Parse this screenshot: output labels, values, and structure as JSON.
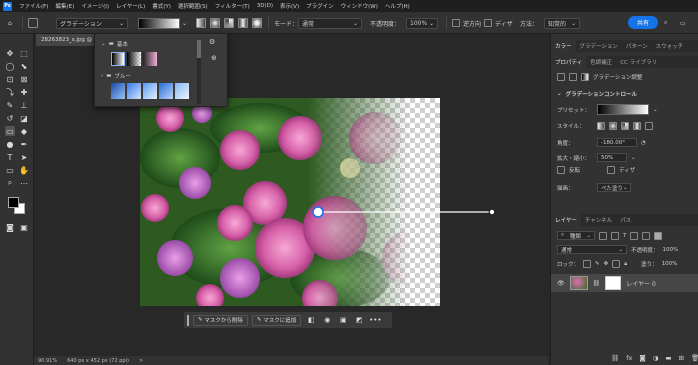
{
  "app": {
    "logo": "Ps"
  },
  "menu": [
    "ファイル(F)",
    "編集(E)",
    "イメージ(I)",
    "レイヤー(L)",
    "書式(Y)",
    "選択範囲(S)",
    "フィルター(T)",
    "3D(D)",
    "表示(V)",
    "プラグイン",
    "ウィンドウ(W)",
    "ヘルプ(H)"
  ],
  "options": {
    "preset": "グラデーション",
    "mode_label": "モード：",
    "mode_value": "通常",
    "opacity_label": "不透明度：",
    "opacity_value": "100%",
    "reverse_label": "逆方向",
    "dither_label": "ディザ",
    "method_label": "方法：",
    "method_value": "知覚的",
    "share": "共有"
  },
  "document": {
    "tab": "28263823_s.jpg @"
  },
  "preset_popup": {
    "group1": "基本",
    "group2": "ブルー"
  },
  "context_bar": {
    "remove": "マスクから削除",
    "add": "マスクに追加",
    "more": "•••"
  },
  "status": {
    "zoom": "90.91%",
    "dims": "640 px x 452 px (72 ppi)",
    "more": ">"
  },
  "right_panel": {
    "top_tabs": [
      "カラー",
      "グラデーション",
      "パターン",
      "スウォッチ"
    ],
    "prop_tabs": [
      "プロパティ",
      "色調補正",
      "CC ライブラリ"
    ],
    "layer_kind": "グラデーション調整",
    "section": "グラデーションコントロール",
    "preset_label": "プリセット：",
    "style_label": "スタイル：",
    "angle_label": "角度：",
    "angle_value": "-180.00°",
    "scale_label": "拡大・縮小：",
    "scale_value": "50%",
    "reverse_label": "反転",
    "dither_label": "ディザ",
    "method_label": "描画：",
    "method_value": "ぺた塗り"
  },
  "layers": {
    "tabs": [
      "レイヤー",
      "チャンネル",
      "パス"
    ],
    "kind": "種類",
    "blend": "通常",
    "opacity_label": "不透明度：",
    "opacity_value": "100%",
    "lock_label": "ロック：",
    "fill_label": "塗り：",
    "fill_value": "100%",
    "layer_name": "レイヤー 0"
  },
  "colors": {
    "accent": "#1473e6",
    "fg": "#000000",
    "bg": "#ffffff"
  }
}
